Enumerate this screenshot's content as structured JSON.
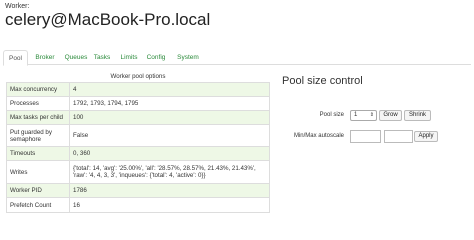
{
  "header": {
    "label": "Worker:",
    "name": "celery@MacBook-Pro.local"
  },
  "tabs": [
    {
      "label": "Pool",
      "active": true
    },
    {
      "label": "Broker"
    },
    {
      "label": "Queues"
    },
    {
      "label": "Tasks"
    },
    {
      "label": "Limits"
    },
    {
      "label": "Config"
    },
    {
      "label": "System"
    }
  ],
  "pool_options": {
    "caption": "Worker pool options",
    "rows": [
      {
        "key": "Max concurrency",
        "value": "4"
      },
      {
        "key": "Processes",
        "value": "1792, 1793, 1794, 1795"
      },
      {
        "key": "Max tasks per child",
        "value": "100"
      },
      {
        "key": "Put guarded by semaphore",
        "value": "False"
      },
      {
        "key": "Timeouts",
        "value": "0, 360"
      },
      {
        "key": "Writes",
        "value": "{'total': 14, 'avg': '25.00%', 'all': '28.57%, 28.57%, 21.43%, 21.43%', 'raw': '4, 4, 3, 3', 'inqueues': {'total': 4, 'active': 0}}"
      },
      {
        "key": "Worker PID",
        "value": "1786"
      },
      {
        "key": "Prefetch Count",
        "value": "16"
      }
    ]
  },
  "pool_size_control": {
    "title": "Pool size control",
    "pool_size_label": "Pool size",
    "pool_size_value": "1",
    "grow_label": "Grow",
    "shrink_label": "Shrink",
    "autoscale_label": "Min/Max autoscale",
    "apply_label": "Apply"
  }
}
